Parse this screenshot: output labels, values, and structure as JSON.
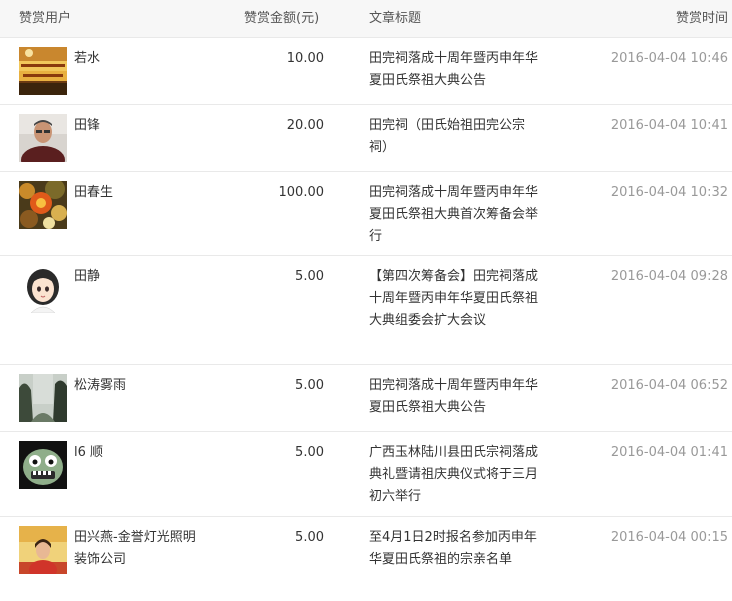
{
  "header": {
    "user": "赞赏用户",
    "amount": "赞赏金额(元)",
    "title": "文章标题",
    "time": "赞赏时间"
  },
  "rows": [
    {
      "user": "若水",
      "amount": "10.00",
      "title": "田完祠落成十周年暨丙申年华夏田氏祭祖大典公告",
      "time": "2016-04-04 10:46",
      "avatar": "banner-avatar"
    },
    {
      "user": "田锋",
      "amount": "20.00",
      "title": "田完祠（田氏始祖田完公宗祠）",
      "time": "2016-04-04 10:41",
      "avatar": "man-avatar"
    },
    {
      "user": "田春生",
      "amount": "100.00",
      "title": "田完祠落成十周年暨丙申年华夏田氏祭祖大典首次筹备会举行",
      "time": "2016-04-04 10:32",
      "avatar": "flower-avatar"
    },
    {
      "user": "田静",
      "amount": "5.00",
      "title": "【第四次筹备会】田完祠落成十周年暨丙申年华夏田氏祭祖大典组委会扩大会议",
      "time": "2016-04-04 09:28",
      "avatar": "cartoon-girl-avatar"
    },
    {
      "user": "松涛雾雨",
      "amount": "5.00",
      "title": "田完祠落成十周年暨丙申年华夏田氏祭祖大典公告",
      "time": "2016-04-04 06:52",
      "avatar": "landscape-avatar"
    },
    {
      "user": "l6 顺",
      "amount": "5.00",
      "title": "广西玉林陆川县田氏宗祠落成典礼暨请祖庆典仪式将于三月初六举行",
      "time": "2016-04-04 01:41",
      "avatar": "monster-avatar"
    },
    {
      "user": "田兴燕-金誉灯光照明装饰公司",
      "amount": "5.00",
      "title": "至4月1日2时报名参加丙申年华夏田氏祭祖的宗亲名单",
      "time": "2016-04-04 00:15",
      "avatar": "woman-avatar"
    }
  ],
  "colors": {
    "header_bg": "#f7f7f7",
    "border": "#e9e9e9",
    "time_text": "#999999"
  }
}
